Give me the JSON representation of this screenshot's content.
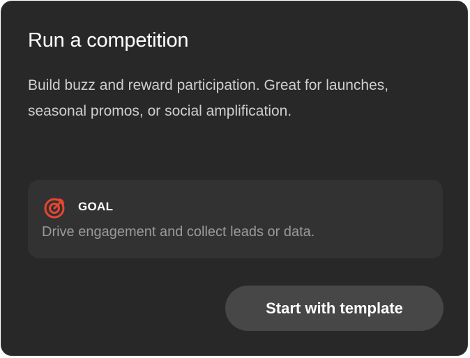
{
  "card": {
    "title": "Run a competition",
    "description": "Build buzz and reward participation. Great for launches, seasonal promos, or social amplification.",
    "goal": {
      "icon": "target-icon",
      "label": "GOAL",
      "text": "Drive engagement and collect leads or data."
    },
    "button_label": "Start with template"
  },
  "colors": {
    "card_background": "#282828",
    "goal_background": "#323232",
    "button_background": "#474747",
    "accent": "#e8452f"
  }
}
